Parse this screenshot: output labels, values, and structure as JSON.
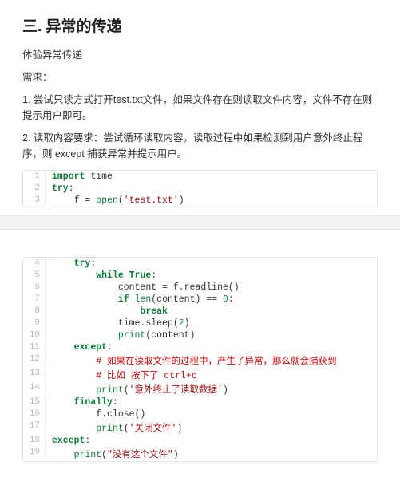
{
  "heading": "三. 异常的传递",
  "intro_lines": [
    "体验异常传递",
    "需求：",
    "1. 尝试只读方式打开test.txt文件，如果文件存在则读取文件内容，文件不存在则提示用户即可。",
    "2. 读取内容要求：尝试循环读取内容，读取过程中如果检测到用户意外终止程序，则 except 捕获异常并提示用户。"
  ],
  "code_block_1": [
    {
      "n": 1,
      "html": "<span class='kw'>import</span> time"
    },
    {
      "n": 2,
      "html": "<span class='kw'>try</span>:"
    },
    {
      "n": 3,
      "html": "    f = <span class='builtin'>open</span>(<span class='str'>'test.txt'</span>)"
    }
  ],
  "code_block_2": [
    {
      "n": 4,
      "html": "    <span class='kw'>try</span>:"
    },
    {
      "n": 5,
      "html": "        <span class='kw'>while</span> <span class='kw'>True</span>:"
    },
    {
      "n": 6,
      "html": "            content = f.readline()"
    },
    {
      "n": 7,
      "html": "            <span class='kw'>if</span> <span class='builtin'>len</span>(content) == <span class='num'>0</span>:"
    },
    {
      "n": 8,
      "html": "                <span class='kw'>break</span>"
    },
    {
      "n": 9,
      "html": "            time.sleep(<span class='num'>2</span>)"
    },
    {
      "n": 10,
      "html": "            <span class='builtin'>print</span>(content)"
    },
    {
      "n": 11,
      "html": "    <span class='kw'>except</span>:"
    },
    {
      "n": 12,
      "html": "        <span class='cmt'># 如果在读取文件的过程中，产生了异常，那么就会捕获到</span>"
    },
    {
      "n": 13,
      "html": "        <span class='cmt'># 比如 按下了 ctrl+c</span>"
    },
    {
      "n": 14,
      "html": "        <span class='builtin'>print</span>(<span class='str'>'意外终止了读取数据'</span>)"
    },
    {
      "n": 15,
      "html": "    <span class='kw'>finally</span>:"
    },
    {
      "n": 16,
      "html": "        f.close()"
    },
    {
      "n": 17,
      "html": "        <span class='builtin'>print</span>(<span class='str'>'关闭文件'</span>)"
    },
    {
      "n": 18,
      "html": "<span class='kw'>except</span>:"
    },
    {
      "n": 19,
      "html": "    <span class='builtin'>print</span>(<span class='str'>\"没有这个文件\"</span>)"
    }
  ]
}
